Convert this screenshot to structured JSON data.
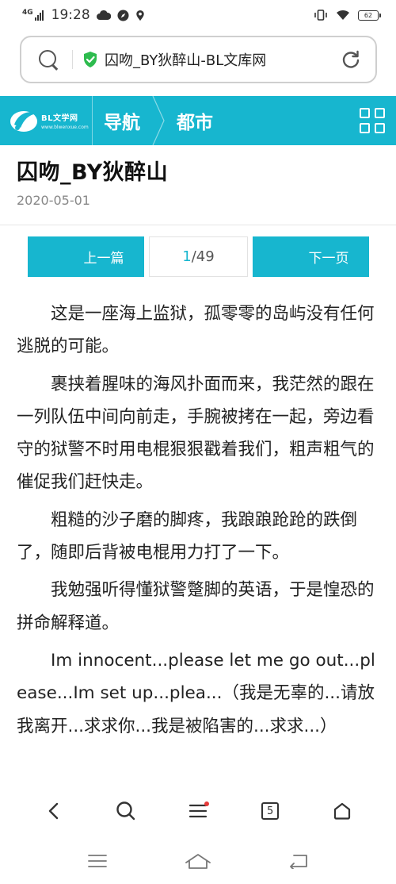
{
  "status_bar": {
    "network": "4G",
    "time": "19:28",
    "battery": "62"
  },
  "address_bar": {
    "url_title": "囚吻_BY狄醉山-BL文库网"
  },
  "site_nav": {
    "logo_title": "BL文学网",
    "logo_url": "www.blwenxue.com",
    "items": [
      {
        "label": "导航"
      },
      {
        "label": "都市"
      }
    ],
    "brand_color": "#17b6cf"
  },
  "article": {
    "title": "囚吻_BY狄醉山",
    "date": "2020-05-01",
    "paragraphs": [
      "这是一座海上监狱，孤零零的岛屿没有任何逃脱的可能。",
      "裹挟着腥味的海风扑面而来，我茫然的跟在一列队伍中间向前走，手腕被拷在一起，旁边看守的狱警不时用电棍狠狠戳着我们，粗声粗气的催促我们赶快走。",
      "粗糙的沙子磨的脚疼，我踉踉跄跄的跌倒了，随即后背被电棍用力打了一下。",
      "我勉强听得懂狱警蹩脚的英语，于是惶恐的拼命解释道。",
      "Im innocent...please let me go out...please...Im set up...plea...（我是无辜的...请放我离开...求求你...我是被陷害的...求求...）"
    ]
  },
  "pager": {
    "prev_label": "上一篇",
    "next_label": "下一页",
    "current_page": "1",
    "total_pages": "/49"
  },
  "browser_toolbar": {
    "tabs_count": "5",
    "icons": [
      "back-icon",
      "search-icon",
      "menu-icon",
      "tabs-icon",
      "home-icon"
    ]
  },
  "system_nav": {
    "icons": [
      "recents-icon",
      "home-icon",
      "back-icon"
    ]
  }
}
